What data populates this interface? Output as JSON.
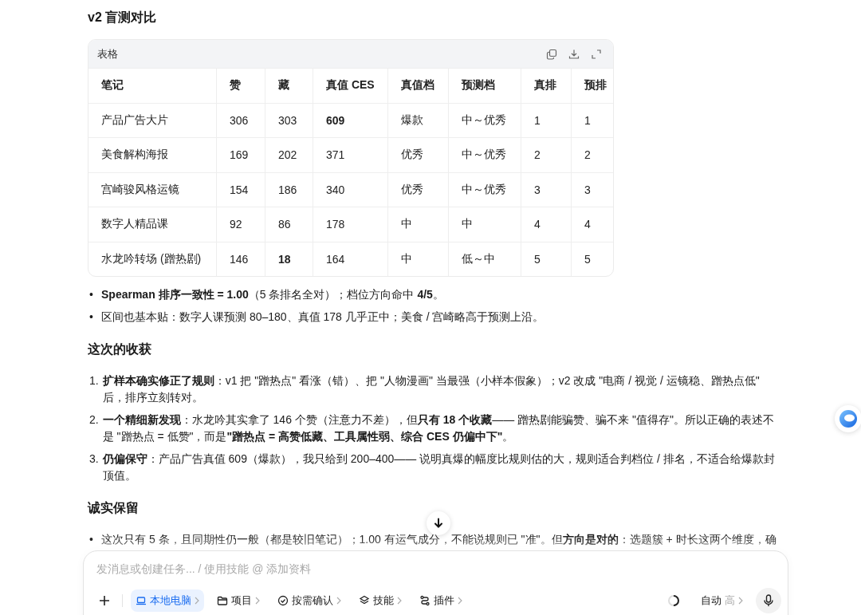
{
  "section_title": "v2 盲测对比",
  "table": {
    "caption": "表格",
    "columns": [
      "笔记",
      "赞",
      "藏",
      "真值 CES",
      "真值档",
      "预测档",
      "真排",
      "预排"
    ],
    "rows": [
      {
        "cells": [
          {
            "text": "产品广告大片",
            "bold": false
          },
          {
            "text": "306",
            "bold": false
          },
          {
            "text": "303",
            "bold": false
          },
          {
            "text": "609",
            "bold": true
          },
          {
            "text": "爆款",
            "bold": false
          },
          {
            "text": "中～优秀",
            "bold": false
          },
          {
            "text": "1",
            "bold": false
          },
          {
            "text": "1",
            "bold": false
          }
        ]
      },
      {
        "cells": [
          {
            "text": "美食解构海报",
            "bold": false
          },
          {
            "text": "169",
            "bold": false
          },
          {
            "text": "202",
            "bold": false
          },
          {
            "text": "371",
            "bold": false
          },
          {
            "text": "优秀",
            "bold": false
          },
          {
            "text": "中～优秀",
            "bold": false
          },
          {
            "text": "2",
            "bold": false
          },
          {
            "text": "2",
            "bold": false
          }
        ]
      },
      {
        "cells": [
          {
            "text": "宫崎骏风格运镜",
            "bold": false
          },
          {
            "text": "154",
            "bold": false
          },
          {
            "text": "186",
            "bold": false
          },
          {
            "text": "340",
            "bold": false
          },
          {
            "text": "优秀",
            "bold": false
          },
          {
            "text": "中～优秀",
            "bold": false
          },
          {
            "text": "3",
            "bold": false
          },
          {
            "text": "3",
            "bold": false
          }
        ]
      },
      {
        "cells": [
          {
            "text": "数字人精品课",
            "bold": false
          },
          {
            "text": "92",
            "bold": false
          },
          {
            "text": "86",
            "bold": false
          },
          {
            "text": "178",
            "bold": false
          },
          {
            "text": "中",
            "bold": false
          },
          {
            "text": "中",
            "bold": false
          },
          {
            "text": "4",
            "bold": false
          },
          {
            "text": "4",
            "bold": false
          }
        ]
      },
      {
        "cells": [
          {
            "text": "水龙吟转场 (蹭热剧)",
            "bold": false
          },
          {
            "text": "146",
            "bold": false
          },
          {
            "text": "18",
            "bold": true
          },
          {
            "text": "164",
            "bold": false
          },
          {
            "text": "中",
            "bold": false
          },
          {
            "text": "低～中",
            "bold": false
          },
          {
            "text": "5",
            "bold": false
          },
          {
            "text": "5",
            "bold": false
          }
        ]
      }
    ]
  },
  "summary_bullets": [
    {
      "marker": "•",
      "text": "**Spearman 排序一致性 = 1.00**（5 条排名全对）；档位方向命中 **4/5**。"
    },
    {
      "marker": "•",
      "text": "区间也基本贴：数字人课预测 80–180、真值 178 几乎正中；美食 / 宫崎略高于预测上沿。"
    }
  ],
  "gains": {
    "title": "这次的收获",
    "items": [
      {
        "marker": "1.",
        "text": "**扩样本确实修正了规则**：v1 把 \"蹭热点\" 看涨（错）、把 \"人物漫画\" 当最强（小样本假象）；v2 改成 \"电商 / 视觉 / 运镜稳、蹭热点低\" 后，排序立刻转对。"
      },
      {
        "marker": "2.",
        "text": "**一个精细新发现**：水龙吟其实拿了 146 个赞（注意力不差），但**只有 18 个收藏**—— 蹭热剧能骗赞、骗不来 \"值得存\"。所以正确的表述不是 \"蹭热点 = 低赞\"，而是**\"蹭热点 = 高赞低藏、工具属性弱、综合 CES 仍偏中下\"**。"
      },
      {
        "marker": "3.",
        "text": "**仍偏保守**：产品广告真值 609（爆款），我只给到 200–400—— 说明真爆的幅度比规则估的大，规则适合判档位 / 排名，不适合给爆款封顶值。"
      }
    ]
  },
  "caveats": {
    "title": "诚实保留",
    "items": [
      {
        "marker": "•",
        "text": "这次只有 5 条，且同期性仍一般（都是较旧笔记）；1.00 有运气成分，不能说规则已 \"准\"。但**方向是对的**：选题簇 + 时长这两个维度，确"
      }
    ]
  },
  "composer": {
    "placeholder": "发消息或创建任务... / 使用技能 @ 添加资料",
    "tools": [
      {
        "label": "本地电脑",
        "kind": "laptop",
        "selected": true
      },
      {
        "label": "项目",
        "kind": "folder",
        "selected": false
      },
      {
        "label": "按需确认",
        "kind": "check",
        "selected": false
      },
      {
        "label": "技能",
        "kind": "layers",
        "selected": false
      },
      {
        "label": "插件",
        "kind": "plugin",
        "selected": false
      }
    ],
    "mode": "自动",
    "level_label": "高"
  }
}
